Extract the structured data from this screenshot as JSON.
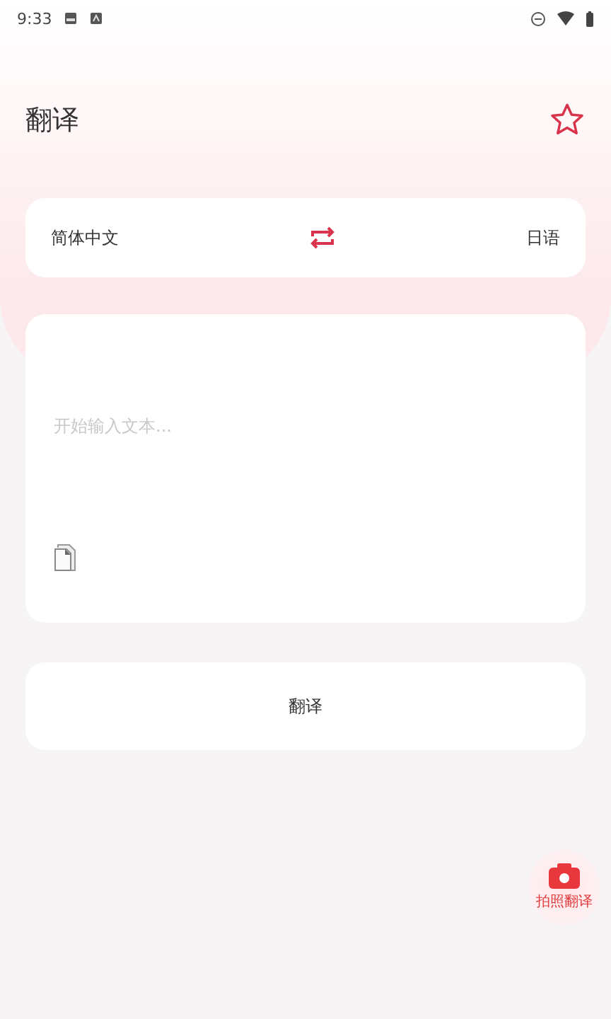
{
  "status_bar": {
    "time": "9:33"
  },
  "header": {
    "title": "翻译",
    "favorite": false
  },
  "languages": {
    "source": "简体中文",
    "target": "日语"
  },
  "input": {
    "placeholder": "开始输入文本..."
  },
  "translate_button": {
    "label": "翻译"
  },
  "camera_button": {
    "label": "拍照翻译"
  }
}
